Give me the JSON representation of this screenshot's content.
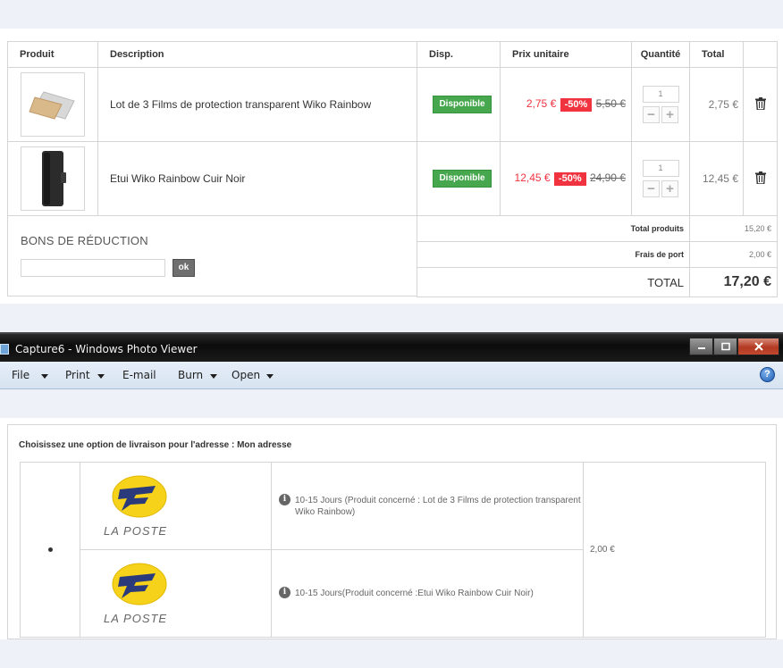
{
  "cart": {
    "headers": {
      "product": "Produit",
      "description": "Description",
      "availability": "Disp.",
      "unit_price": "Prix unitaire",
      "quantity": "Quantité",
      "total": "Total"
    },
    "rows": [
      {
        "description": "Lot de 3 Films de protection transparent Wiko Rainbow",
        "availability": "Disponible",
        "price_new": "2,75 €",
        "reduction": "-50%",
        "price_old": "5,50 €",
        "quantity": "1",
        "total": "2,75 €",
        "thumb_icon": "screen-protector-icon"
      },
      {
        "description": "Etui Wiko Rainbow Cuir Noir",
        "availability": "Disponible",
        "price_new": "12,45 €",
        "reduction": "-50%",
        "price_old": "24,90 €",
        "quantity": "1",
        "total": "12,45 €",
        "thumb_icon": "phone-case-icon"
      }
    ],
    "voucher": {
      "title": "BONS DE RÉDUCTION",
      "input_value": "",
      "ok_label": "ok"
    },
    "totals": {
      "products_label": "Total produits",
      "products_value": "15,20 €",
      "shipping_label": "Frais de port",
      "shipping_value": "2,00 €",
      "grand_label": "TOTAL",
      "grand_value": "17,20 €"
    },
    "colors": {
      "available_green": "#46a74e",
      "price_red": "#f13340"
    }
  },
  "window": {
    "title": "Capture6 - Windows Photo Viewer",
    "menu": [
      "File",
      "Print",
      "E-mail",
      "Burn",
      "Open"
    ],
    "help": "?"
  },
  "shipping": {
    "title": "Choisissez une option de livraison pour l'adresse : Mon adresse",
    "carrier_name": "LA POSTE",
    "options": [
      {
        "text": "10-15 Jours (Produit concerné : Lot de 3 Films de protection transparent Wiko Rainbow)"
      },
      {
        "text": "10-15 Jours(Produit concerné :Etui Wiko Rainbow Cuir Noir)"
      }
    ],
    "price": "2,00 €",
    "colors": {
      "logo_yellow": "#f6d21a",
      "logo_blue": "#2a3a7a"
    }
  }
}
